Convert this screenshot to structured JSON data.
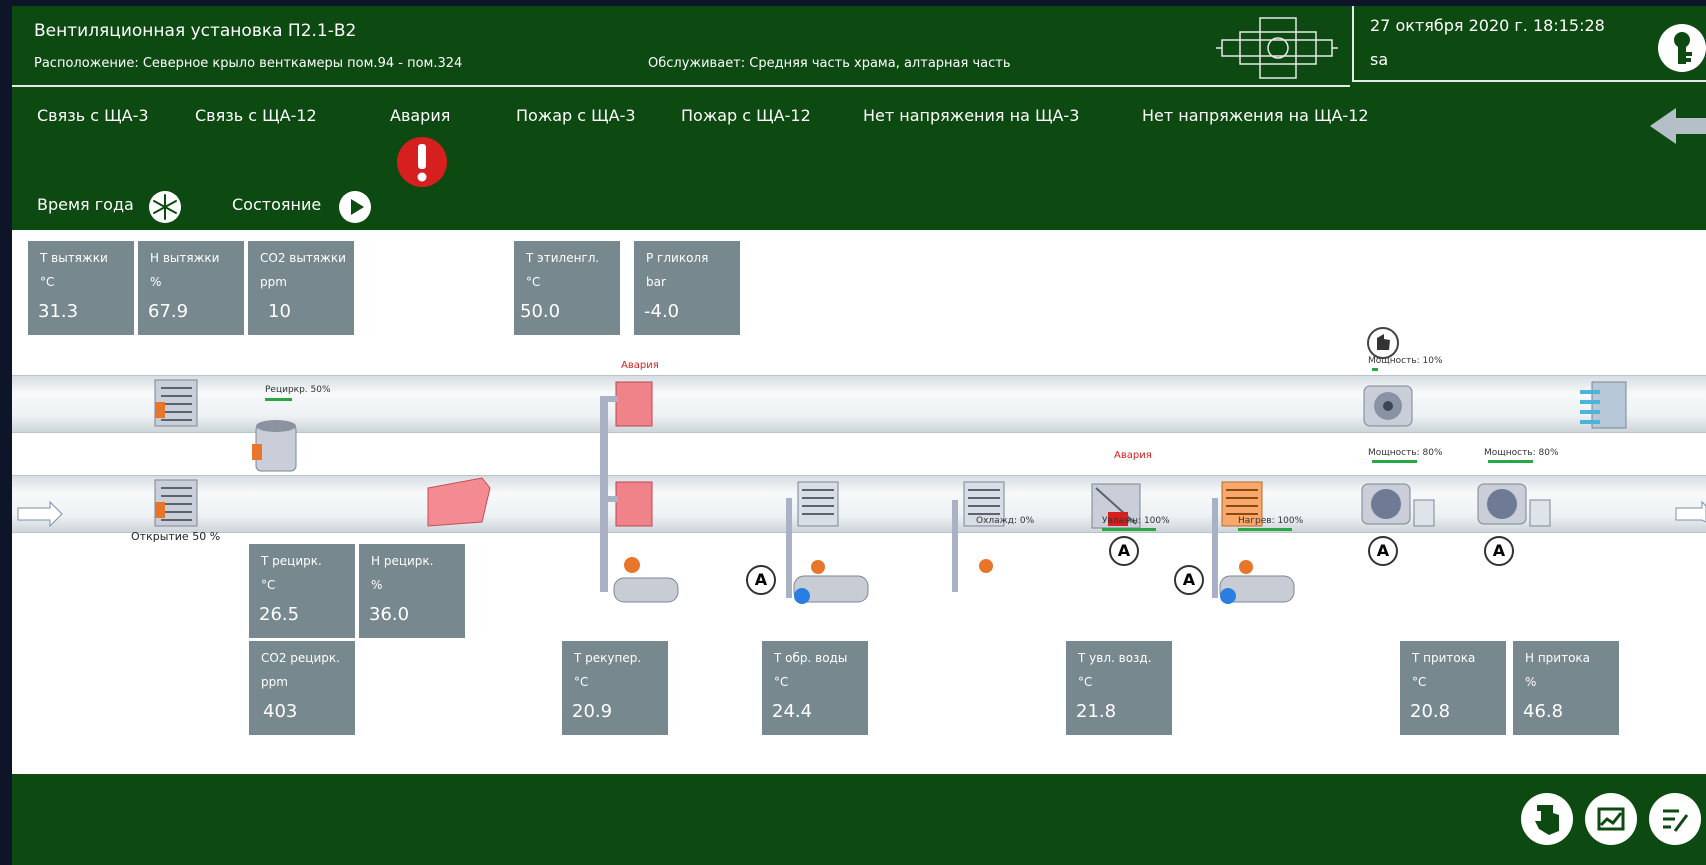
{
  "header": {
    "title": "Вентиляционная установка П2.1-В2",
    "location": "Расположение: Северное крыло венткамеры пом.94 - пом.324",
    "serves": "Обслуживает: Средняя часть храма, алтарная часть",
    "datetime": "27 октября 2020 г. 18:15:28",
    "user": "sa"
  },
  "alarms": [
    "Связь с ЩА-3",
    "Связь с ЩА-12",
    "Авария",
    "Пожар с ЩА-3",
    "Пожар с ЩА-12",
    "Нет напряжения на ЩА-3",
    "Нет напряжения на ЩА-12"
  ],
  "status": {
    "season_label": "Время года",
    "state_label": "Состояние"
  },
  "tiles": {
    "t_exhaust": {
      "name": "Т вытяжки",
      "unit": "°C",
      "value": "31.3"
    },
    "h_exhaust": {
      "name": "Н вытяжки",
      "unit": "%",
      "value": "67.9"
    },
    "co2_exhaust": {
      "name": "CO2 вытяжки",
      "unit": "ppm",
      "value": "10"
    },
    "t_glycol": {
      "name": "Т этиленгл.",
      "unit": "°C",
      "value": "50.0"
    },
    "p_glycol": {
      "name": "Р гликоля",
      "unit": "bar",
      "value": "-4.0"
    },
    "t_recirc": {
      "name": "Т рецирк.",
      "unit": "°C",
      "value": "26.5"
    },
    "h_recirc": {
      "name": "Н рецирк.",
      "unit": "%",
      "value": "36.0"
    },
    "co2_recirc": {
      "name": "CO2 рецирк.",
      "unit": "ppm",
      "value": "403"
    },
    "t_recup": {
      "name": "Т рекупер.",
      "unit": "°C",
      "value": "20.9"
    },
    "t_return_water": {
      "name": "Т обр. воды",
      "unit": "°C",
      "value": "24.4"
    },
    "t_humid_air": {
      "name": "Т увл. возд.",
      "unit": "°C",
      "value": "21.8"
    },
    "t_supply": {
      "name": "Т притока",
      "unit": "°C",
      "value": "20.8"
    },
    "h_supply": {
      "name": "Н притока",
      "unit": "%",
      "value": "46.8"
    }
  },
  "diagram": {
    "opening": "Открытие  50 %",
    "recirc": "Рециркр.  50%",
    "alarm_text": "Авария",
    "cooling": "Охлажд:  0%",
    "humid": "Увлажн: 100%",
    "heating": "Нагрев:  100%",
    "power_exhaust": "Мощность:  10%",
    "power_supply1": "Мощность:  80%",
    "power_supply2": "Мощность:  80%",
    "auto_mark": "A",
    "levels": {
      "recirc": 0.5,
      "cooling": 0,
      "humid": 1,
      "heating": 1,
      "power_exhaust": 0.1,
      "power_supply1": 0.8,
      "power_supply2": 0.8
    }
  },
  "colors": {
    "header_bg": "#0d4a12",
    "alarm_red": "#d62020",
    "tile_bg": "#77888f",
    "level_bar": "#27a843"
  }
}
